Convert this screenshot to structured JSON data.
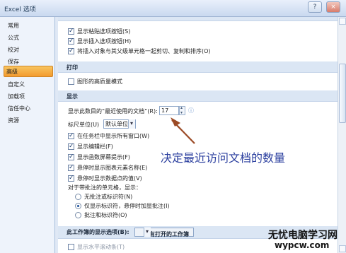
{
  "window": {
    "title": "Excel 选项",
    "help": "?",
    "close": "×"
  },
  "sidebar": {
    "items": [
      {
        "label": "常用"
      },
      {
        "label": "公式"
      },
      {
        "label": "校对"
      },
      {
        "label": "保存"
      },
      {
        "label": "高级"
      },
      {
        "label": "自定义"
      },
      {
        "label": "加载项"
      },
      {
        "label": "信任中心"
      },
      {
        "label": "资源"
      }
    ]
  },
  "cut_options": {
    "paste_options": "显示粘贴选项按钮(S)",
    "insert_options": "显示插入选项按钮(H)",
    "cut_copy_sort": "将插入对象与其父级单元格一起剪切、复制和排序(O)"
  },
  "print": {
    "header": "打印",
    "high_quality": "图形的高质量模式"
  },
  "display": {
    "header": "显示",
    "recent_docs_label": "显示此数目的“最近使用的文档”(R):",
    "recent_docs_value": "17",
    "ruler_label": "标尺单位(U)",
    "ruler_value": "默认单位",
    "windows_taskbar": "在任务栏中显示所有窗口(W)",
    "formula_bar": "显示编辑栏(F)",
    "function_tips": "显示函数屏幕提示(F)",
    "chart_names": "悬停时显示图表元素名称(E)",
    "data_point_values": "悬停时显示数据点的值(V)",
    "comments_label": "对于带批注的单元格，显示：",
    "no_comments": "无批注或标识符(N)",
    "indicators_only": "仅显示标识符，悬停时加显批注(I)",
    "comments_and_indicators": "批注和标识符(O)"
  },
  "workbook_display": {
    "header": "此工作簿的显示选项(B):",
    "workbook_value": "没有打开的工作簿",
    "horizontal_scroll": "显示水平滚动条(T)"
  },
  "annotation": "决定最近访问文档的数量",
  "watermark": {
    "title": "无忧电脑学习网",
    "url": "wypcw.com"
  },
  "colors": {
    "annotation_blue": "#2b3f9f",
    "arrow_brown": "#9b4a25",
    "active_orange": "#f3a13a"
  }
}
